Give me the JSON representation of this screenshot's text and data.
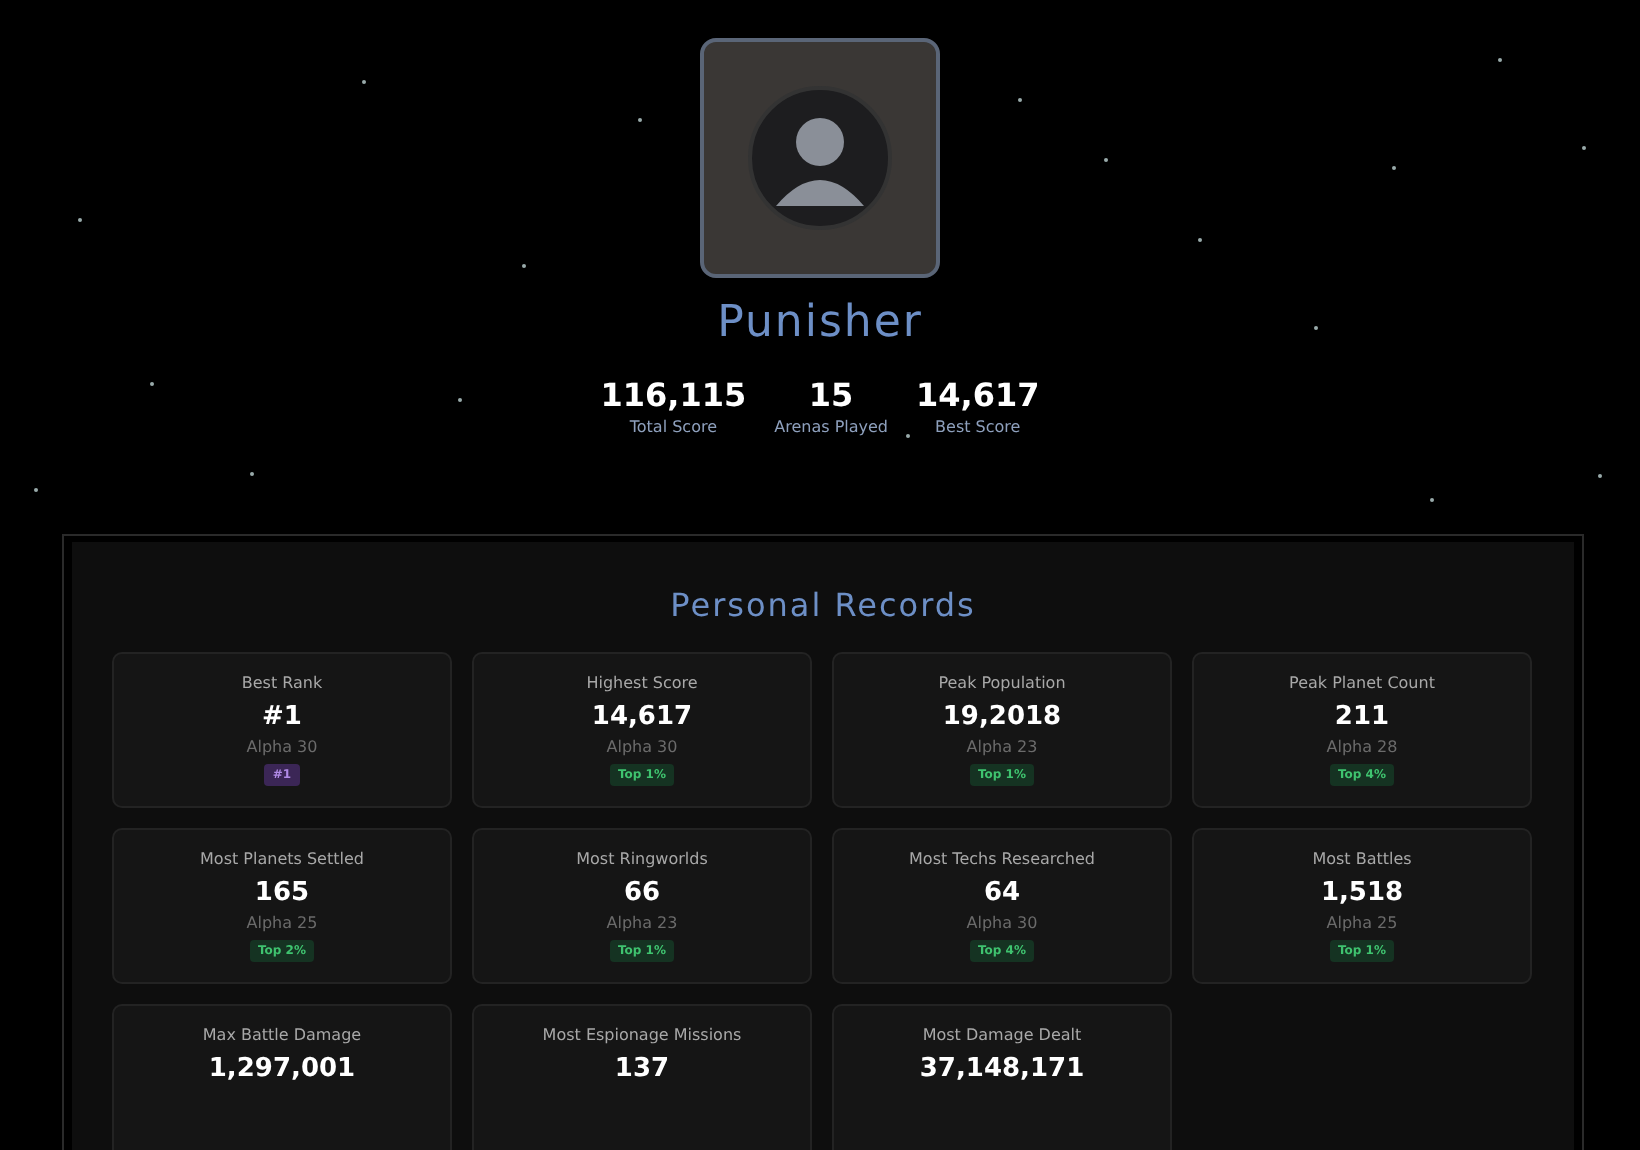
{
  "profile": {
    "name": "Punisher"
  },
  "stats": [
    {
      "value": "116,115",
      "label": "Total Score"
    },
    {
      "value": "15",
      "label": "Arenas Played"
    },
    {
      "value": "14,617",
      "label": "Best Score"
    }
  ],
  "records": {
    "title": "Personal Records",
    "items": [
      {
        "label": "Best Rank",
        "value": "#1",
        "arena": "Alpha 30",
        "badge": "#1",
        "kind": "rank"
      },
      {
        "label": "Highest Score",
        "value": "14,617",
        "arena": "Alpha 30",
        "badge": "Top 1%",
        "kind": "top"
      },
      {
        "label": "Peak Population",
        "value": "19,2018",
        "arena": "Alpha 23",
        "badge": "Top 1%",
        "kind": "top"
      },
      {
        "label": "Peak Planet Count",
        "value": "211",
        "arena": "Alpha 28",
        "badge": "Top 4%",
        "kind": "top"
      },
      {
        "label": "Most Planets Settled",
        "value": "165",
        "arena": "Alpha 25",
        "badge": "Top 2%",
        "kind": "top"
      },
      {
        "label": "Most Ringworlds",
        "value": "66",
        "arena": "Alpha 23",
        "badge": "Top 1%",
        "kind": "top"
      },
      {
        "label": "Most Techs Researched",
        "value": "64",
        "arena": "Alpha 30",
        "badge": "Top 4%",
        "kind": "top"
      },
      {
        "label": "Most Battles",
        "value": "1,518",
        "arena": "Alpha 25",
        "badge": "Top 1%",
        "kind": "top"
      },
      {
        "label": "Max Battle Damage",
        "value": "1,297,001"
      },
      {
        "label": "Most Espionage Missions",
        "value": "137"
      },
      {
        "label": "Most Damage Dealt",
        "value": "37,148,171"
      }
    ]
  }
}
